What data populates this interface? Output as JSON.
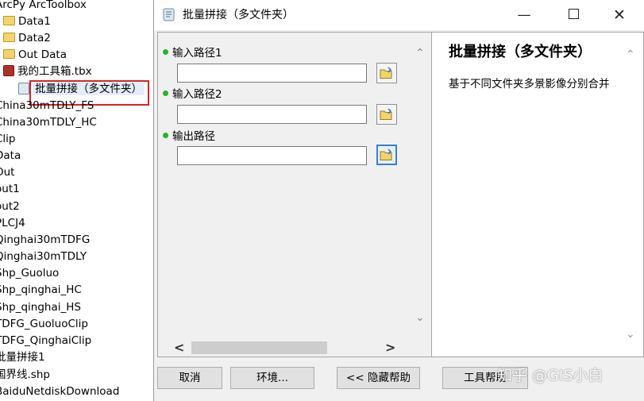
{
  "tree": {
    "items": [
      {
        "label": "ArcPy ArcToolbox",
        "icon": "none"
      },
      {
        "label": "Data1",
        "icon": "folder-icon"
      },
      {
        "label": "Data2",
        "icon": "folder-icon"
      },
      {
        "label": "Out Data",
        "icon": "folder-icon"
      },
      {
        "label": "我的工具箱.tbx",
        "icon": "toolbox-icon"
      },
      {
        "label": "批量拼接（多文件夹）",
        "icon": "script-tool-icon"
      },
      {
        "label": "China30mTDLY_FS",
        "icon": "none"
      },
      {
        "label": "China30mTDLY_HC",
        "icon": "none"
      },
      {
        "label": "Clip",
        "icon": "none"
      },
      {
        "label": "Data",
        "icon": "none"
      },
      {
        "label": "Out",
        "icon": "none"
      },
      {
        "label": "out1",
        "icon": "none"
      },
      {
        "label": "out2",
        "icon": "none"
      },
      {
        "label": "PLCJ4",
        "icon": "none"
      },
      {
        "label": "Qinghai30mTDFG",
        "icon": "none"
      },
      {
        "label": "Qinghai30mTDLY",
        "icon": "none"
      },
      {
        "label": "Shp_Guoluo",
        "icon": "none"
      },
      {
        "label": "Shp_qinghai_HC",
        "icon": "none"
      },
      {
        "label": "Shp_qinghai_HS",
        "icon": "none"
      },
      {
        "label": "TDFG_GuoluoClip",
        "icon": "none"
      },
      {
        "label": "TDFG_QinghaiClip",
        "icon": "none"
      },
      {
        "label": "批量拼接1",
        "icon": "none"
      },
      {
        "label": "国界线.shp",
        "icon": "none"
      },
      {
        "label": "BaiduNetdiskDownload",
        "icon": "none"
      }
    ],
    "highlight_color": "#e02020"
  },
  "dialog": {
    "title": "批量拼接（多文件夹）",
    "window_controls": {
      "minimize": "—",
      "close": "✕"
    },
    "params": [
      {
        "label": "输入路径1",
        "value": ""
      },
      {
        "label": "输入路径2",
        "value": ""
      },
      {
        "label": "输出路径",
        "value": ""
      }
    ],
    "scroll": {
      "up": "⌃",
      "down": "⌄",
      "left": "<",
      "right": ">"
    },
    "help": {
      "title": "批量拼接（多文件夹）",
      "description": "基于不同文件夹多景影像分别合并"
    },
    "buttons": {
      "cancel": "取消",
      "environments": "环境...",
      "hide_help": "<< 隐藏帮助",
      "tool_help": "工具帮助"
    },
    "required_dot_color": "#26b426"
  },
  "watermark": "知乎 @GIS小白"
}
